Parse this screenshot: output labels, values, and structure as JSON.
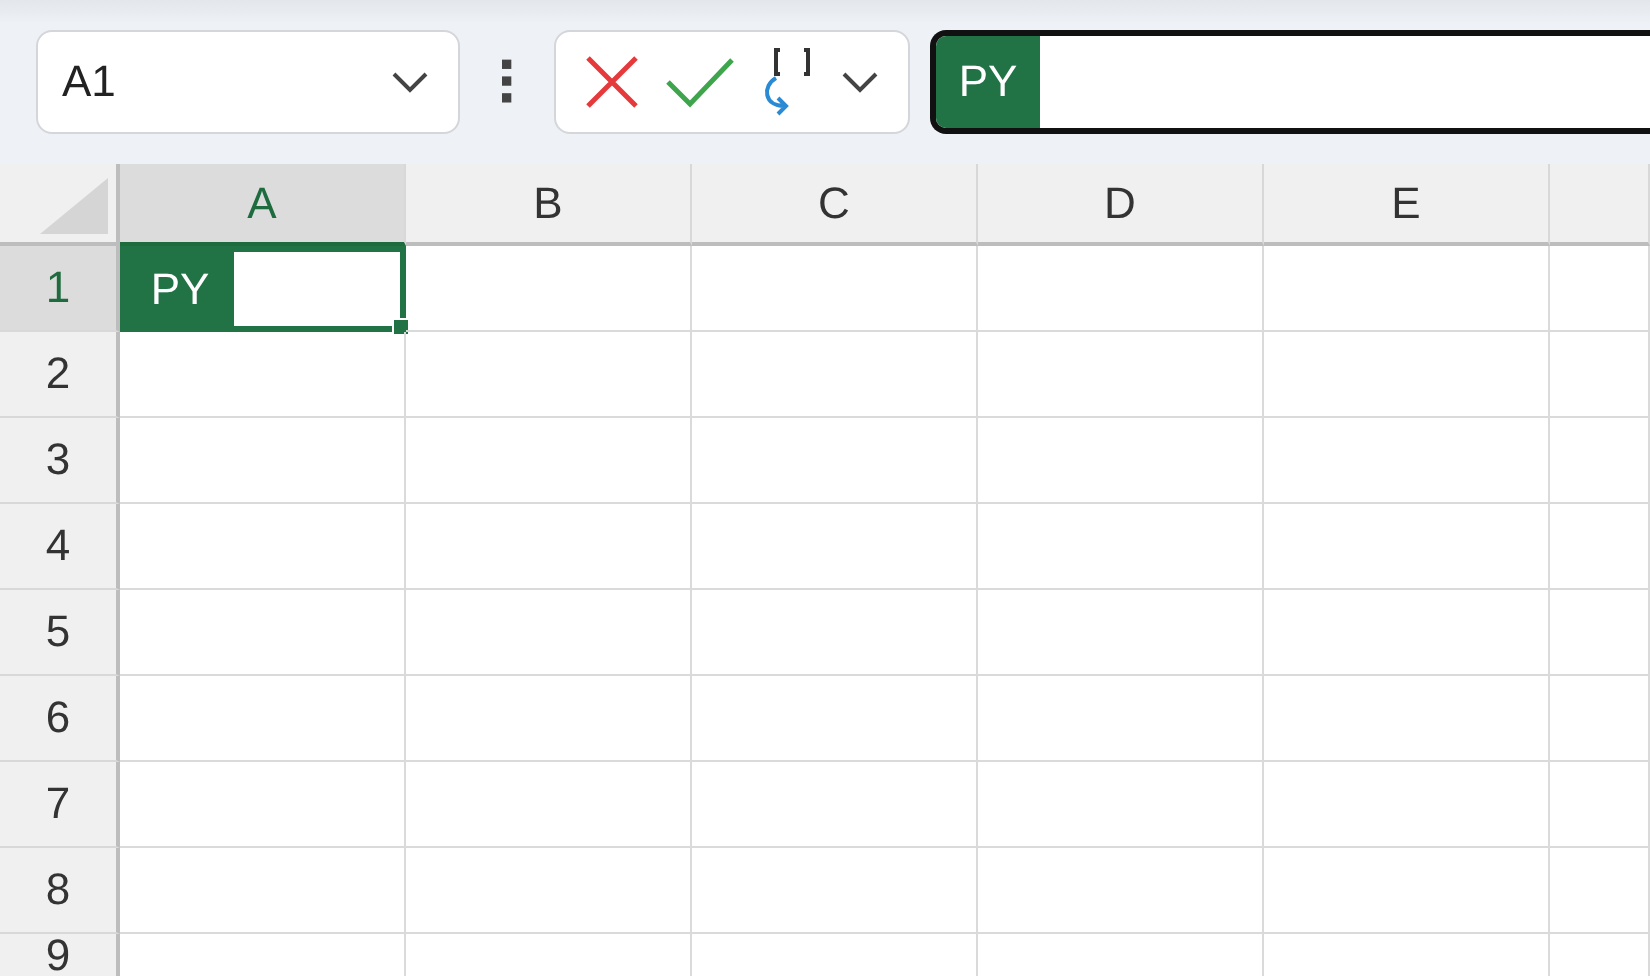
{
  "name_box": {
    "value": "A1"
  },
  "formula_bar": {
    "badge": "PY"
  },
  "columns": [
    {
      "label": "A",
      "selected": true
    },
    {
      "label": "B",
      "selected": false
    },
    {
      "label": "C",
      "selected": false
    },
    {
      "label": "D",
      "selected": false
    },
    {
      "label": "E",
      "selected": false
    }
  ],
  "rows": [
    {
      "label": "1",
      "selected": true,
      "badge": "PY"
    },
    {
      "label": "2",
      "selected": false
    },
    {
      "label": "3",
      "selected": false
    },
    {
      "label": "4",
      "selected": false
    },
    {
      "label": "5",
      "selected": false
    },
    {
      "label": "6",
      "selected": false
    },
    {
      "label": "7",
      "selected": false
    },
    {
      "label": "8",
      "selected": false
    },
    {
      "label": "9",
      "selected": false
    }
  ]
}
